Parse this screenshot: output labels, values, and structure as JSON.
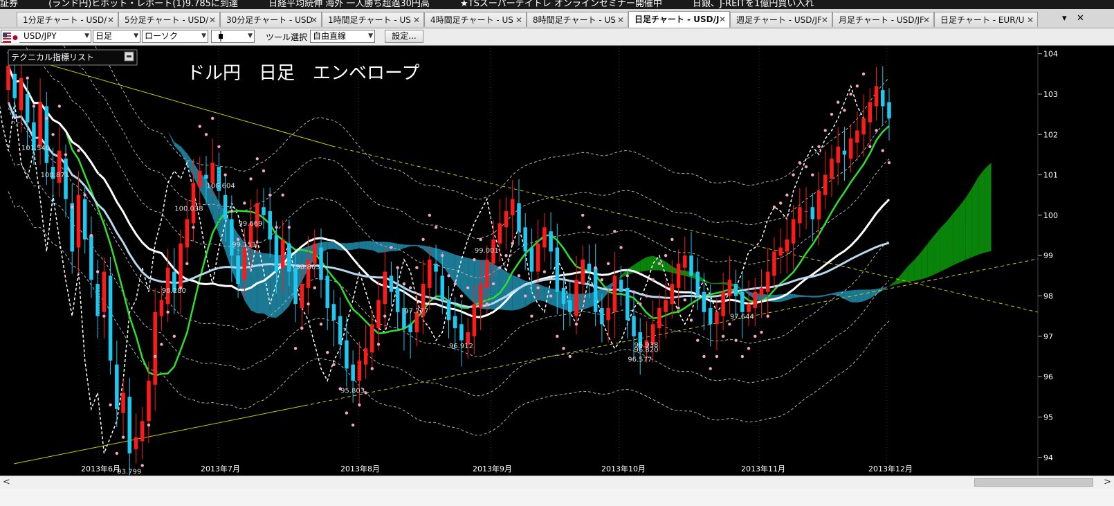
{
  "ticker": {
    "items": [
      "証券",
      "(ランド円)ヒボット・レポート(1)9.785に到達",
      "日経平均続伸 海外 一人勝ち超過30円高",
      "★TSスーパーデイトレ オンラインセミナー開催中",
      "日銀、J-REITを1億円買い入れ"
    ]
  },
  "tabs": [
    {
      "label": "1分足チャート - USD/",
      "active": false
    },
    {
      "label": "5分足チャート - USD/",
      "active": false
    },
    {
      "label": "30分足チャート - USD",
      "active": false
    },
    {
      "label": "1時間足チャート - US",
      "active": false
    },
    {
      "label": "4時間足チャート - US",
      "active": false
    },
    {
      "label": "8時間足チャート - US",
      "active": false
    },
    {
      "label": "日足チャート - USD/J",
      "active": true
    },
    {
      "label": "週足チャート - USD/JF",
      "active": false
    },
    {
      "label": "月足チャート - USD/JF",
      "active": false
    },
    {
      "label": "日足チャート - EUR/U",
      "active": false
    }
  ],
  "tab_controls": {
    "dropdown": "▾",
    "close": "✕"
  },
  "toolbar": {
    "symbol": "USD/JPY",
    "timeframe": "日足",
    "chart_style": "ローソク",
    "chart_style_icon": "candle-icon",
    "tool_label": "ツール選択",
    "tool_value": "自由直線",
    "settings_label": "設定..."
  },
  "indicator_panel": {
    "label": "テクニカル指標リスト"
  },
  "colors": {
    "background": "#000000",
    "up_candle": "#ff1a1a",
    "down_candle": "#1fc8f0",
    "kumo_bull": "#0a8a0a",
    "kumo_bear": "#1c7f9c",
    "ma_short": "#2ee02e",
    "ma_mid": "#ffffff",
    "ma_long": "#b8d8ee",
    "parabolic": "#f4a6c8",
    "envelope": "#b0b0b0",
    "trendline": "#cccc00"
  },
  "chart_data": {
    "type": "candlestick",
    "title": "ドル円　日足　エンベロープ",
    "symbol": "USD/JPY",
    "ylim": [
      93.55,
      104.2
    ],
    "y_ticks": [
      94,
      95,
      96,
      97,
      98,
      99,
      100,
      101,
      102,
      103,
      104
    ],
    "x_ticks": [
      "2013年6月",
      "2013年7月",
      "2013年8月",
      "2013年9月",
      "2013年10月",
      "2013年11月",
      "2013年12月"
    ],
    "grid": false,
    "annotations": [
      {
        "text": "101.540",
        "value": 101.54
      },
      {
        "text": "100.871",
        "value": 100.871
      },
      {
        "text": "100.038",
        "value": 100.038
      },
      {
        "text": "98.280",
        "value": 98.28
      },
      {
        "text": "99.151",
        "value": 99.151
      },
      {
        "text": "98.863",
        "value": 98.863
      },
      {
        "text": "100.604",
        "value": 100.604
      },
      {
        "text": "99.669",
        "value": 99.669
      },
      {
        "text": "97.777",
        "value": 97.777
      },
      {
        "text": "99.001",
        "value": 99.001
      },
      {
        "text": "96.912",
        "value": 96.912
      },
      {
        "text": "96.820",
        "value": 96.82
      },
      {
        "text": "95.803",
        "value": 95.803
      },
      {
        "text": "96.577",
        "value": 96.577
      },
      {
        "text": "96.938",
        "value": 96.938
      },
      {
        "text": "97.644",
        "value": 97.644
      },
      {
        "text": "93.799",
        "value": 93.799
      }
    ],
    "ohlc_close": [
      103.7,
      102.9,
      103.4,
      102.3,
      101.6,
      102.8,
      101.3,
      100.9,
      101.6,
      100.4,
      99.1,
      100.5,
      99.4,
      98.4,
      97.5,
      98.6,
      96.4,
      95.2,
      95.6,
      94.1,
      94.5,
      94.9,
      95.9,
      97.6,
      97.9,
      98.7,
      98.1,
      99.3,
      99.9,
      100.8,
      101.1,
      100.9,
      101.3,
      100.6,
      99.9,
      99.0,
      98.3,
      99.2,
      99.8,
      100.3,
      100.0,
      99.4,
      98.6,
      99.4,
      98.6,
      97.8,
      98.3,
      98.9,
      99.3,
      98.4,
      97.7,
      97.4,
      96.8,
      96.2,
      95.9,
      96.4,
      96.7,
      97.3,
      97.9,
      98.6,
      98.1,
      97.6,
      97.2,
      97.1,
      97.6,
      98.3,
      98.9,
      98.6,
      97.9,
      97.4,
      97.2,
      96.9,
      97.1,
      97.8,
      98.3,
      98.9,
      99.4,
      99.8,
      100.1,
      100.4,
      99.6,
      99.1,
      98.6,
      99.3,
      99.7,
      99.1,
      98.1,
      97.8,
      97.6,
      98.4,
      98.9,
      98.6,
      97.6,
      97.3,
      97.7,
      98.5,
      98.1,
      97.4,
      97.0,
      96.7,
      96.9,
      97.3,
      97.7,
      97.9,
      98.3,
      98.8,
      99.0,
      98.5,
      98.0,
      97.6,
      97.3,
      97.6,
      98.1,
      98.4,
      98.0,
      97.6,
      97.8,
      98.1,
      98.2,
      98.6,
      99.1,
      99.2,
      99.4,
      99.9,
      100.2,
      100.1,
      99.9,
      100.6,
      101.0,
      101.4,
      101.7,
      101.5,
      101.9,
      102.1,
      102.4,
      102.8,
      103.2,
      102.7,
      102.4
    ],
    "ohlc_open": [
      103.1,
      103.5,
      102.6,
      103.0,
      102.3,
      101.7,
      102.7,
      101.2,
      100.8,
      101.4,
      100.3,
      99.2,
      100.4,
      99.5,
      98.3,
      97.6,
      98.5,
      96.3,
      95.1,
      95.5,
      94.2,
      94.4,
      94.9,
      95.8,
      97.5,
      97.8,
      98.6,
      98.2,
      99.2,
      99.8,
      100.7,
      101.0,
      100.8,
      101.2,
      100.5,
      99.9,
      99.0,
      98.4,
      99.2,
      99.7,
      100.2,
      100.1,
      99.5,
      98.7,
      99.3,
      98.7,
      97.7,
      98.2,
      98.8,
      99.2,
      98.5,
      97.8,
      97.5,
      96.9,
      96.3,
      95.9,
      96.3,
      96.6,
      97.2,
      97.8,
      98.5,
      98.2,
      97.7,
      97.3,
      97.1,
      97.5,
      98.2,
      98.8,
      98.5,
      97.9,
      97.5,
      97.3,
      96.8,
      97.0,
      97.7,
      98.2,
      98.8,
      99.3,
      99.7,
      100.0,
      100.3,
      99.7,
      99.2,
      98.6,
      99.2,
      99.6,
      99.2,
      98.2,
      97.9,
      97.5,
      98.3,
      98.8,
      98.7,
      97.7,
      97.4,
      97.6,
      98.4,
      98.2,
      97.5,
      97.1,
      96.7,
      96.8,
      97.2,
      97.6,
      97.8,
      98.2,
      98.7,
      99.0,
      98.6,
      98.1,
      97.7,
      97.3,
      97.5,
      98.0,
      98.3,
      98.1,
      97.6,
      97.7,
      98.0,
      98.1,
      98.5,
      99.0,
      99.1,
      99.3,
      99.8,
      100.1,
      100.2,
      99.9,
      100.5,
      100.9,
      101.3,
      101.6,
      101.4,
      101.8,
      102.0,
      102.3,
      102.7,
      103.1,
      102.8
    ]
  }
}
